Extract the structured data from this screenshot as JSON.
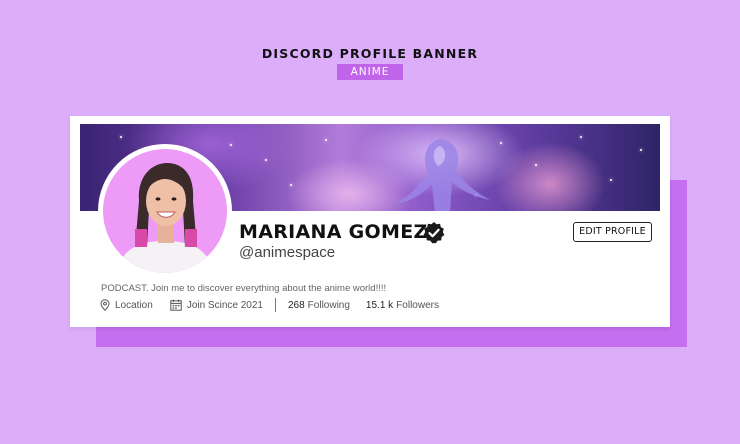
{
  "header": {
    "title": "DISCORD PROFILE BANNER",
    "tag": "ANIME"
  },
  "profile": {
    "name": "MARIANA GOMEZ",
    "handle": "@animespace",
    "edit_label": "EDIT PROFILE",
    "bio": "PODCAST. Join me to discover everything about the anime world!!!!",
    "location": "Location",
    "joined": "Join Scince 2021",
    "following_count": "268",
    "following_label": "Following",
    "followers_count": "15.1 k",
    "followers_label": "Followers"
  },
  "colors": {
    "background": "#dcaefa",
    "accent": "#c065ea",
    "avatar_bg": "#ee9bf8"
  },
  "icons": [
    "verified-badge-icon",
    "location-pin-icon",
    "calendar-icon"
  ]
}
